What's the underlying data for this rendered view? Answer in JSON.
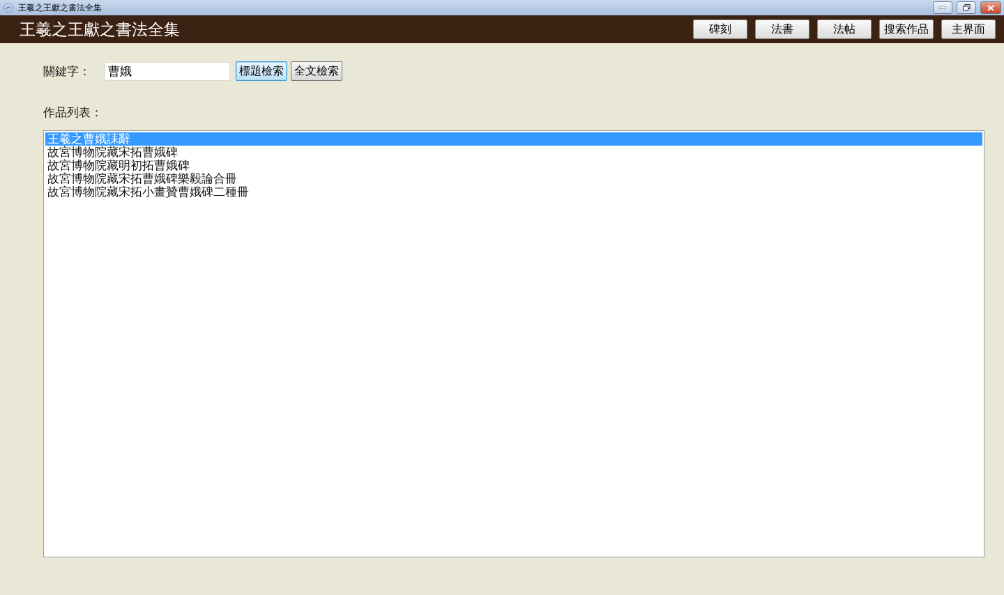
{
  "window": {
    "title": "王羲之王獻之書法全集"
  },
  "header": {
    "title": "王羲之王獻之書法全集",
    "nav": [
      "碑刻",
      "法書",
      "法帖",
      "搜索作品",
      "主界面"
    ]
  },
  "search": {
    "label": "關鍵字：",
    "value": "曹娥",
    "buttons": [
      {
        "label": "標題檢索",
        "focused": true
      },
      {
        "label": "全文檢索",
        "focused": false
      }
    ]
  },
  "works": {
    "label": "作品列表：",
    "items": [
      {
        "title": "王羲之曹娥誄辭",
        "selected": true
      },
      {
        "title": "故宮博物院藏宋拓曹娥碑",
        "selected": false
      },
      {
        "title": "故宮博物院藏明初拓曹娥碑",
        "selected": false
      },
      {
        "title": "故宮博物院藏宋拓曹娥碑樂毅論合冊",
        "selected": false
      },
      {
        "title": "故宮博物院藏宋拓小畫贊曹娥碑二種冊",
        "selected": false
      }
    ]
  }
}
